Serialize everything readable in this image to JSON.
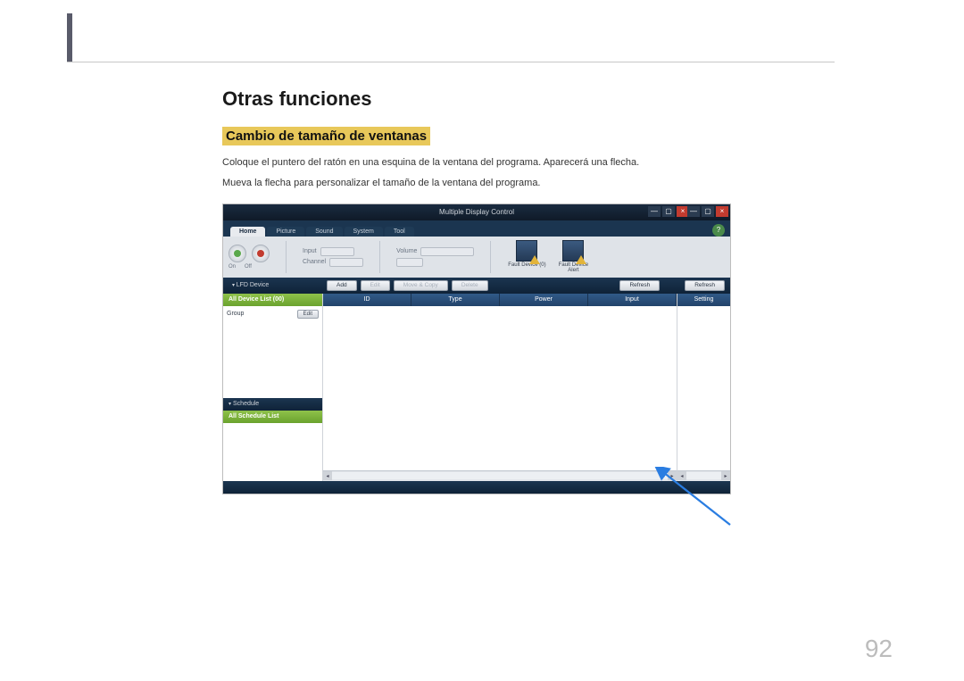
{
  "page_number": "92",
  "heading": "Otras funciones",
  "subheading": "Cambio de tamaño de ventanas",
  "para1": "Coloque el puntero del ratón en una esquina de la ventana del programa. Aparecerá una flecha.",
  "para2": "Mueva la flecha para personalizar el tamaño de la ventana del programa.",
  "app": {
    "title": "Multiple Display Control",
    "win_min": "—",
    "win_max": "▢",
    "win_close": "×",
    "help": "?",
    "tabs": {
      "home": "Home",
      "picture": "Picture",
      "sound": "Sound",
      "system": "System",
      "tool": "Tool"
    },
    "toolbar": {
      "on": "On",
      "off": "Off",
      "input_lbl": "Input",
      "channel_lbl": "Channel",
      "volume_lbl": "Volume",
      "slider_val": "",
      "fault_device": "Fault Device (0)",
      "fault_alert": "Fault Device Alert"
    },
    "bar2": {
      "section": "LFD Device",
      "add": "Add",
      "edit": "Edit",
      "move": "Move & Copy",
      "delete": "Delete",
      "refresh": "Refresh",
      "refresh2": "Refresh"
    },
    "side": {
      "all_devices": "All Device List (00)",
      "group": "Group",
      "editbtn": "Edit",
      "schedule": "Schedule",
      "all_schedule": "All Schedule List"
    },
    "cols": {
      "id": "ID",
      "type": "Type",
      "power": "Power",
      "input": "Input",
      "setting": "Setting"
    },
    "scroll_left": "◂",
    "scroll_right": "▸"
  }
}
